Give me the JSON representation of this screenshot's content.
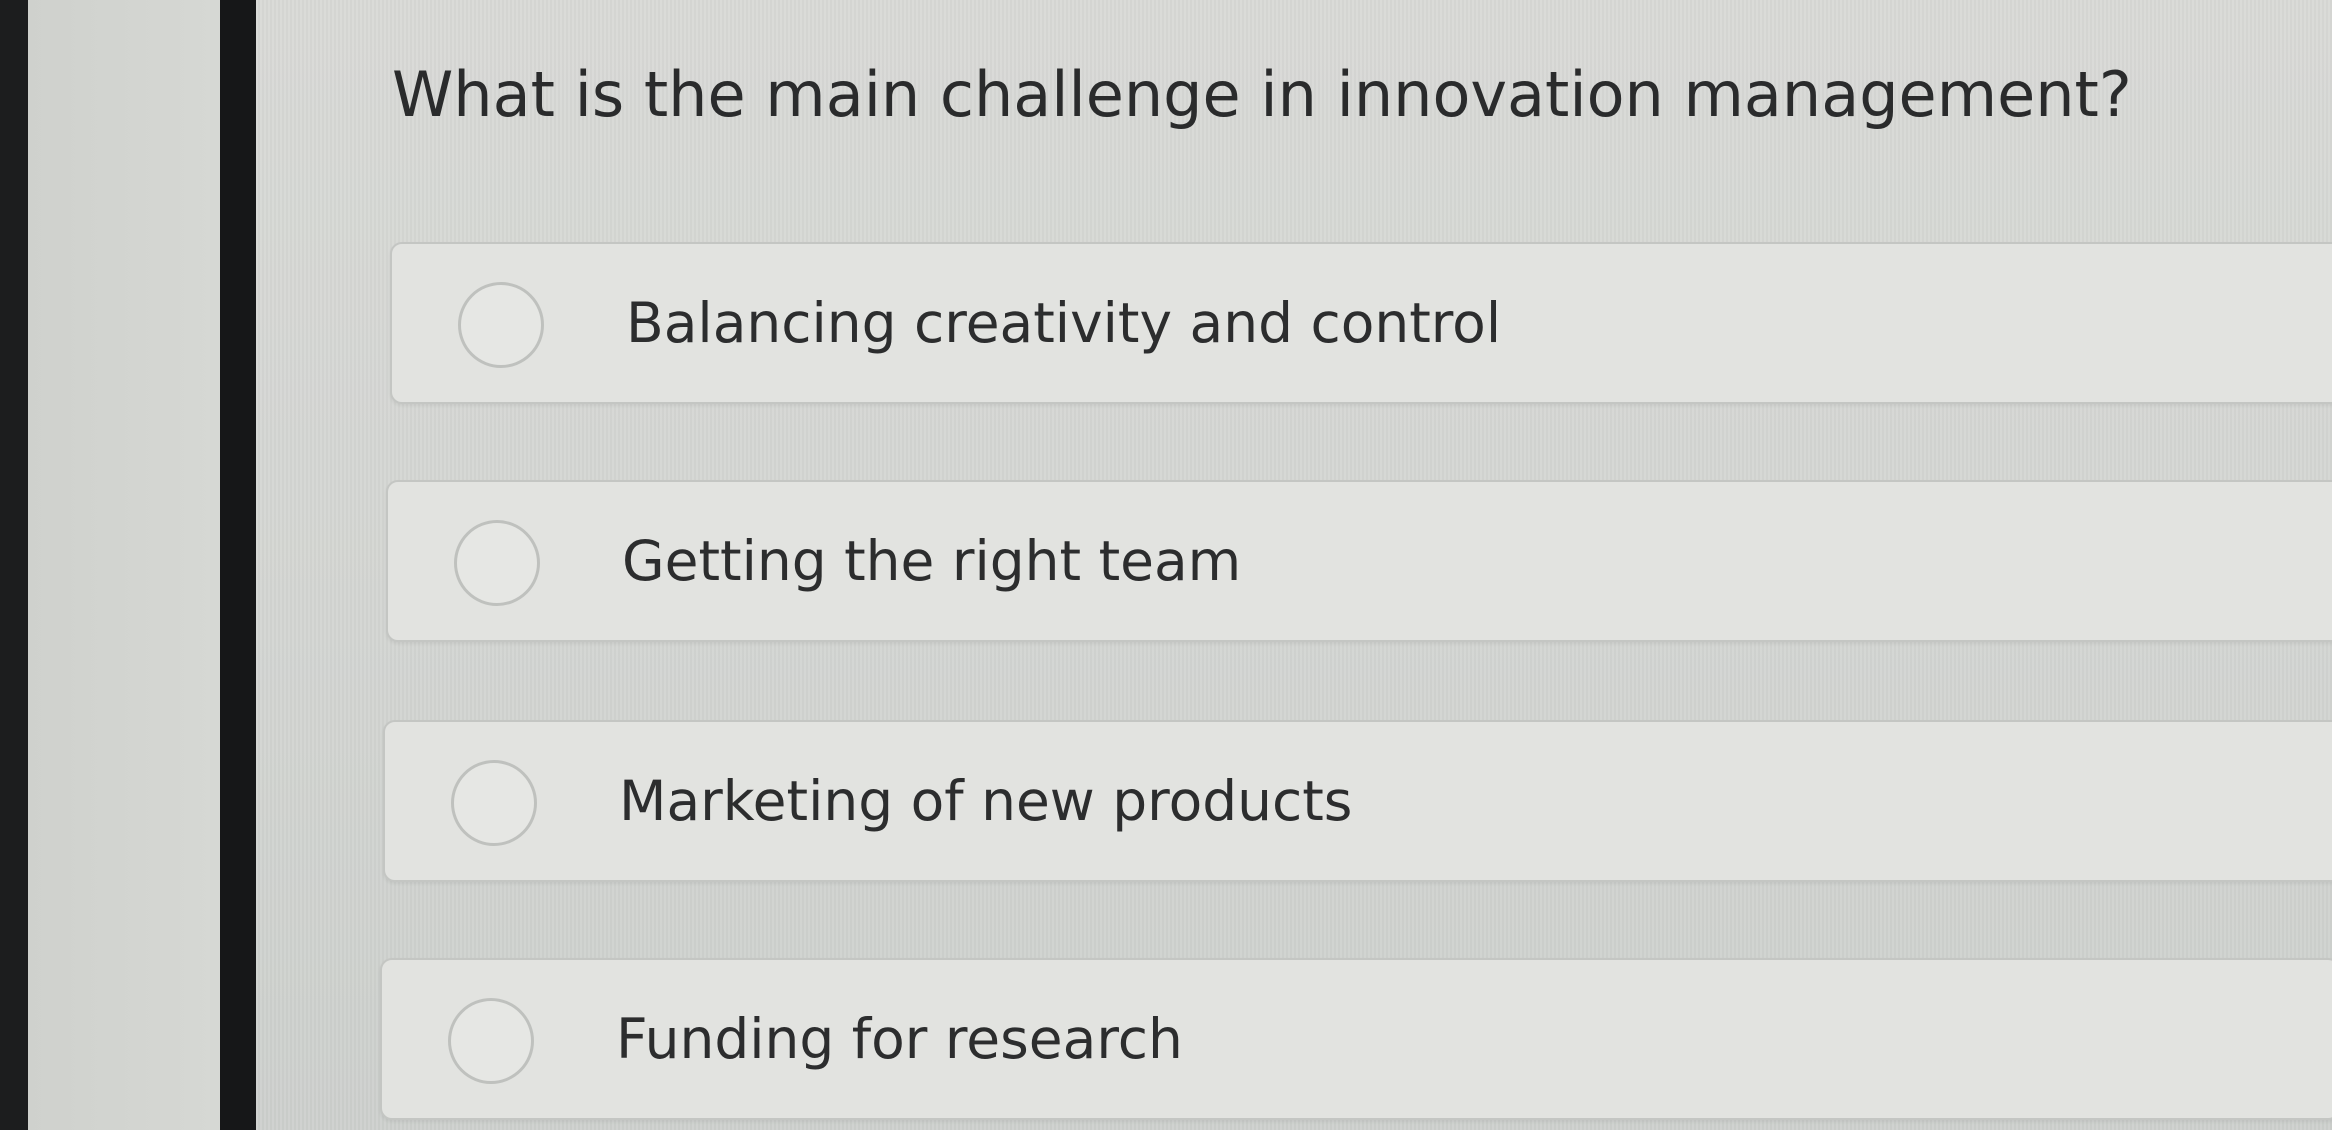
{
  "question": {
    "text": "What is the main challenge in innovation management?"
  },
  "options": [
    {
      "label": "Balancing creativity and control",
      "selected": false
    },
    {
      "label": "Getting the right team",
      "selected": false
    },
    {
      "label": "Marketing of new products",
      "selected": false
    },
    {
      "label": "Funding for research",
      "selected": false
    }
  ],
  "icons": {
    "radio": "radio-unchecked-icon"
  },
  "colors": {
    "question_text": "#2a2b2c",
    "option_background": "#e2e3e0",
    "option_border": "#c4c6c3",
    "sidebar_divider": "#161718"
  }
}
